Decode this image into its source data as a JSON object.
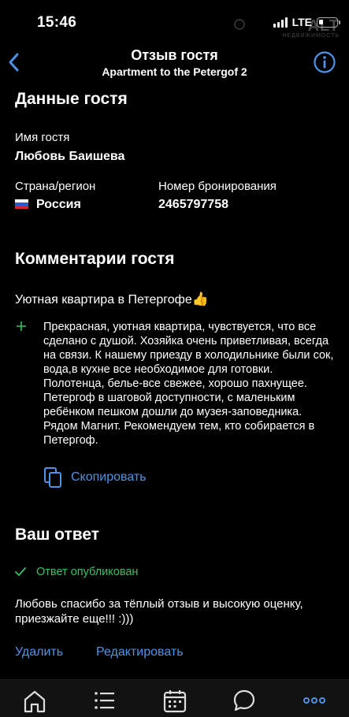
{
  "status_bar": {
    "time": "15:46",
    "network": "LTE"
  },
  "watermark": {
    "text": "ALT",
    "subtext": "НЕДВИЖИМОСТЬ"
  },
  "nav": {
    "title": "Отзыв гостя",
    "subtitle": "Apartment to the Petergof 2"
  },
  "guest_section": {
    "title": "Данные гостя",
    "name_label": "Имя гостя",
    "name_value": "Любовь Баишева",
    "country_label": "Страна/регион",
    "country_value": "Россия",
    "booking_label": "Номер бронирования",
    "booking_value": "2465797758"
  },
  "comments_section": {
    "title": "Комментарии гостя",
    "review_title": "Уютная квартира в Петергофе",
    "review_emoji": "👍",
    "review_text": "Прекрасная, уютная квартира,  чувствуется, что все сделано с душой. Хозяйка очень приветливая, всегда на связи. К нашему приезду в холодильнике были  сок, вода,в кухне все необходимое для готовки. Полотенца, белье-все свежее, хорошо пахнущее. Петергоф в шаговой доступности, с маленьким ребёнком пешком дошли до музея-заповедника. Рядом Магнит. Рекомендуем тем, кто собирается в Петергоф.",
    "copy_label": "Скопировать"
  },
  "reply_section": {
    "title": "Ваш ответ",
    "status": "Ответ опубликован",
    "reply_text": "Любовь спасибо за тёплый отзыв и высокую оценку, приезжайте еще!!! :)))",
    "delete_label": "Удалить",
    "edit_label": "Редактировать"
  },
  "tab_bar": {
    "items": [
      {
        "icon": "home-icon"
      },
      {
        "icon": "list-icon"
      },
      {
        "icon": "calendar-icon"
      },
      {
        "icon": "chat-icon"
      },
      {
        "icon": "more-icon",
        "active": true
      }
    ]
  },
  "colors": {
    "accent": "#4f93e8",
    "success": "#3bbf65",
    "background": "#000000"
  }
}
